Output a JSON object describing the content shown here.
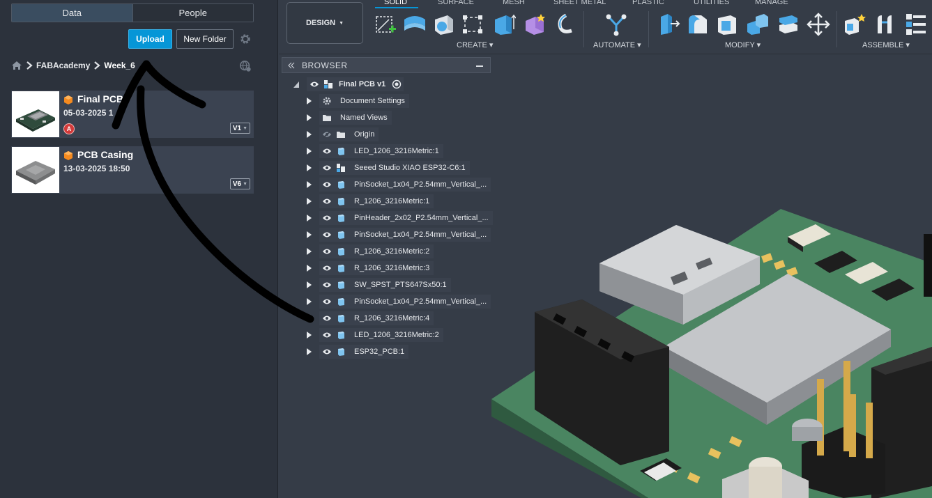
{
  "data_panel": {
    "tabs": [
      {
        "label": "Data",
        "active": true
      },
      {
        "label": "People",
        "active": false
      }
    ],
    "upload_label": "Upload",
    "new_folder_label": "New Folder",
    "breadcrumb": [
      "FABAcademy",
      "Week_6"
    ],
    "files": [
      {
        "name": "Final PCB",
        "date": "05-03-2025 1",
        "version": "V1",
        "badge": "A"
      },
      {
        "name": "PCB Casing",
        "date": "13-03-2025 18:50",
        "version": "V6"
      }
    ]
  },
  "toolbar": {
    "workspace": "DESIGN",
    "tabs": [
      "SOLID",
      "SURFACE",
      "MESH",
      "SHEET METAL",
      "PLASTIC",
      "UTILITIES",
      "MANAGE"
    ],
    "active_tab": "SOLID",
    "groups": [
      "CREATE",
      "AUTOMATE",
      "MODIFY",
      "ASSEMBLE"
    ]
  },
  "browser": {
    "title": "BROWSER",
    "root": "Final PCB v1",
    "items": [
      {
        "label": "Document Settings",
        "icon": "gear-icon",
        "eye": false
      },
      {
        "label": "Named Views",
        "icon": "folder-icon",
        "eye": false
      },
      {
        "label": "Origin",
        "icon": "folder-icon",
        "eye": "hidden"
      },
      {
        "label": "LED_1206_3216Metric:1",
        "icon": "component-icon",
        "eye": true
      },
      {
        "label": "Seeed Studio XIAO ESP32-C6:1",
        "icon": "assembly-icon",
        "eye": true
      },
      {
        "label": "PinSocket_1x04_P2.54mm_Vertical_...",
        "icon": "component-icon",
        "eye": true
      },
      {
        "label": "R_1206_3216Metric:1",
        "icon": "component-icon",
        "eye": true
      },
      {
        "label": "PinHeader_2x02_P2.54mm_Vertical_...",
        "icon": "component-icon",
        "eye": true
      },
      {
        "label": "PinSocket_1x04_P2.54mm_Vertical_...",
        "icon": "component-icon",
        "eye": true
      },
      {
        "label": "R_1206_3216Metric:2",
        "icon": "component-icon",
        "eye": true
      },
      {
        "label": "R_1206_3216Metric:3",
        "icon": "component-icon",
        "eye": true
      },
      {
        "label": "SW_SPST_PTS647Sx50:1",
        "icon": "component-icon",
        "eye": true
      },
      {
        "label": "PinSocket_1x04_P2.54mm_Vertical_...",
        "icon": "component-icon",
        "eye": true
      },
      {
        "label": "R_1206_3216Metric:4",
        "icon": "component-icon",
        "eye": true
      },
      {
        "label": "LED_1206_3216Metric:2",
        "icon": "component-icon",
        "eye": true
      },
      {
        "label": "ESP32_PCB:1",
        "icon": "component-icon",
        "eye": true
      }
    ]
  }
}
